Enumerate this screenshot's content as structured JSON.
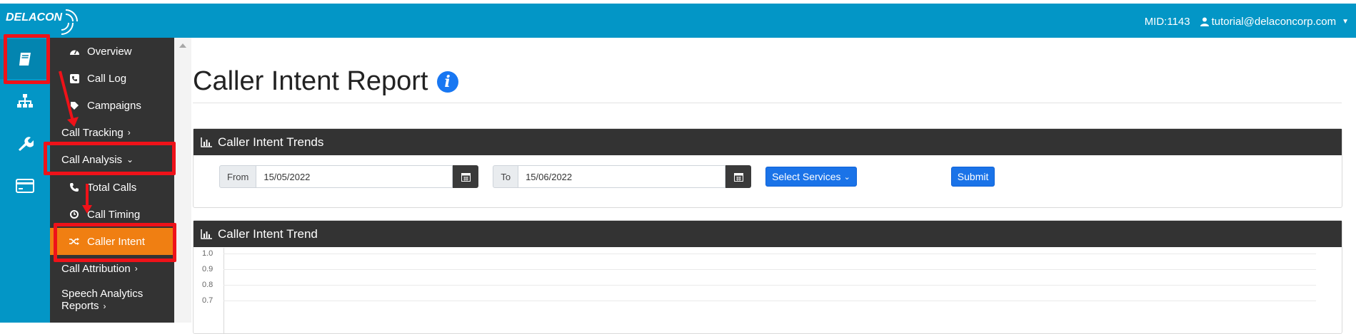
{
  "header": {
    "logo_text": "DELACON",
    "mid": "MID:1143",
    "user_email": "tutorial@delaconcorp.com"
  },
  "rail": {
    "items": [
      {
        "icon": "book-icon"
      },
      {
        "icon": "sitemap-icon"
      },
      {
        "icon": "wrench-icon"
      },
      {
        "icon": "credit-card-icon"
      }
    ]
  },
  "sidebar": {
    "overview": "Overview",
    "call_log": "Call Log",
    "campaigns": "Campaigns",
    "call_tracking": "Call Tracking",
    "call_analysis": "Call Analysis",
    "total_calls": "Total Calls",
    "call_timing": "Call Timing",
    "caller_intent": "Caller Intent",
    "call_attribution": "Call Attribution",
    "speech_analytics_1": "Speech Analytics",
    "speech_analytics_2": "Reports"
  },
  "main": {
    "title": "Caller Intent Report",
    "trends_panel_title": "Caller Intent Trends",
    "from_label": "From",
    "from_value": "15/05/2022",
    "to_label": "To",
    "to_value": "15/06/2022",
    "select_services": "Select Services",
    "submit": "Submit",
    "trend_panel_title": "Caller Intent Trend"
  },
  "chart_data": {
    "type": "line",
    "title": "Caller Intent Trend",
    "y_ticks": [
      "1.0",
      "0.9",
      "0.8",
      "0.7"
    ],
    "ylim": [
      0.7,
      1.0
    ],
    "series": []
  },
  "colors": {
    "brand": "#0396c6",
    "sidebar": "#333333",
    "active": "#f07f12",
    "highlight": "#ef1219",
    "primary_button": "#1a73e8"
  }
}
